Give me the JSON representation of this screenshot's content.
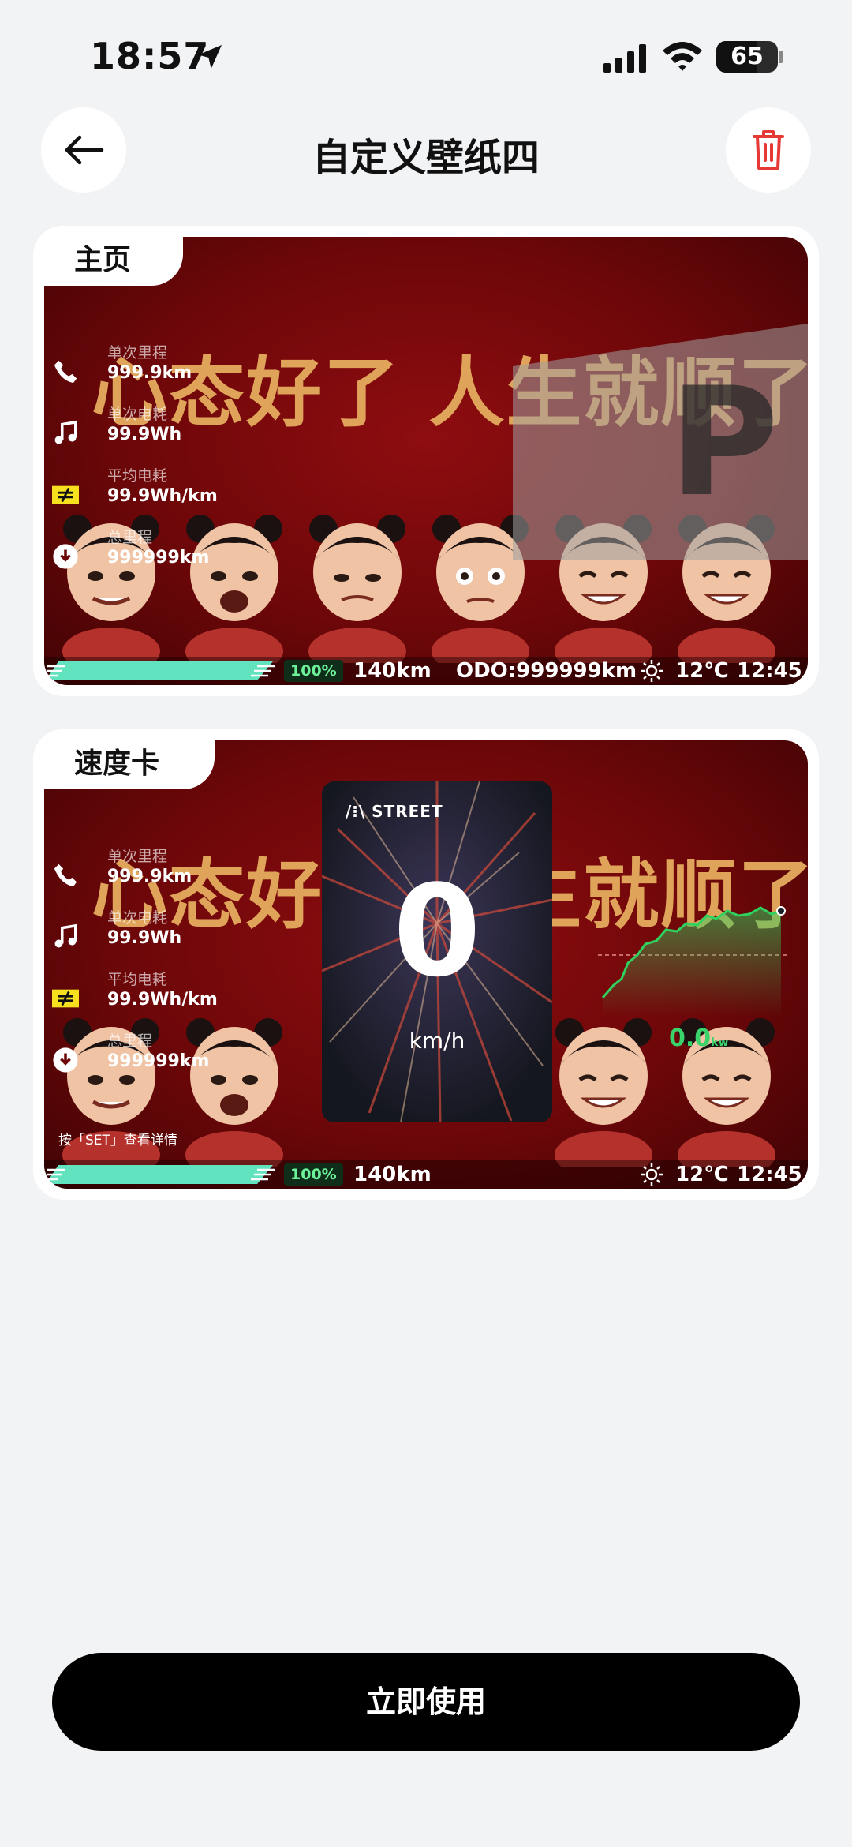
{
  "status_bar": {
    "time": "18:57",
    "battery": "65",
    "battery_level": 0.65
  },
  "header": {
    "title": "自定义壁纸四"
  },
  "cards": [
    {
      "tag": "主页",
      "slogan": "心态好了 人生就顺了",
      "stats": [
        {
          "label": "单次里程",
          "value": "999.9km"
        },
        {
          "label": "单次电耗",
          "value": "99.9Wh"
        },
        {
          "label": "平均电耗",
          "value": "99.9Wh/km"
        },
        {
          "label": "总里程",
          "value": "999999km"
        }
      ],
      "gear": "P",
      "charge": "100%",
      "range": "140km",
      "odo": "ODO:999999km",
      "temp": "12℃",
      "clock": "12:45"
    },
    {
      "tag": "速度卡",
      "slogan": "心态好了 人生就顺了",
      "stats": [
        {
          "label": "单次里程",
          "value": "999.9km"
        },
        {
          "label": "单次电耗",
          "value": "99.9Wh"
        },
        {
          "label": "平均电耗",
          "value": "99.9Wh/km"
        },
        {
          "label": "总里程",
          "value": "999999km"
        }
      ],
      "speed_card": {
        "brand": "STREET",
        "speed": "0",
        "unit": "km/h"
      },
      "power_value": "0.0",
      "power_unit": "kw",
      "hint": "按「SET」查看详情",
      "charge": "100%",
      "range": "140km",
      "temp": "12℃",
      "clock": "12:45"
    }
  ],
  "use_button": {
    "label": "立即使用"
  }
}
